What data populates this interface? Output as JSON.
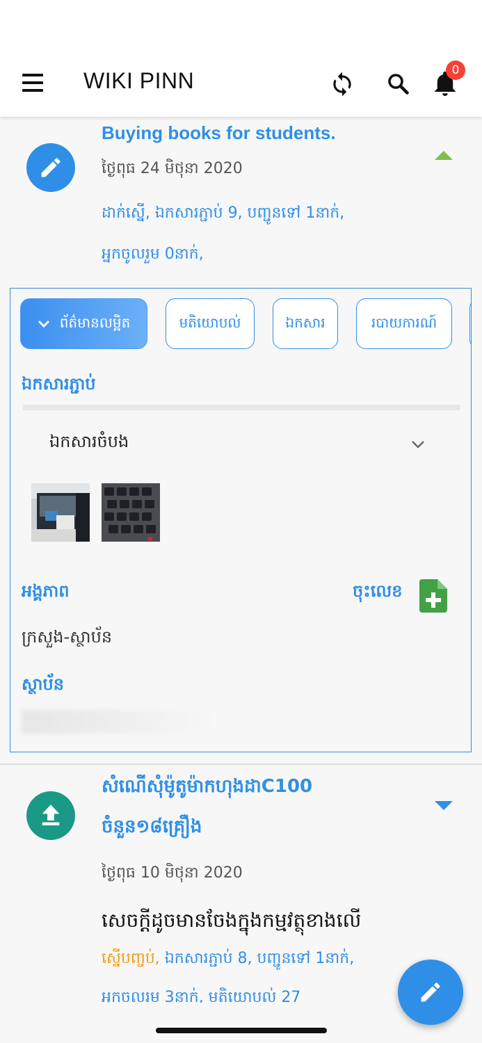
{
  "header": {
    "app_title": "WIKI PINN",
    "notification_count": "0"
  },
  "card1": {
    "title": "Buying books for students.",
    "date": "ថ្ងៃពុធ 24 មិថុនា 2020",
    "meta_line1": "ដាក់ស្នើ, ឯកសារភ្ជាប់ 9, បញ្ជូនទៅ 1នាក់,",
    "meta_line2": "អ្នកចូលរួម 0នាក់,"
  },
  "panel": {
    "tabs": [
      "ព័ត៌មានលម្អិត",
      "មតិយោបល់",
      "ឯកសារ",
      "របាយការណ៍"
    ],
    "attachments_heading": "ឯកសារភ្ជាប់",
    "attachment_group": "ឯកសារចំបង",
    "entity_heading": "អង្គភាព",
    "register_label": "ចុះលេខ",
    "entity_value": "ក្រសួង-ស្ថាប័ន",
    "institution_heading": "ស្ថាប័ន"
  },
  "card2": {
    "title_line1": "សំណើសុំម៉ូតូម៉ាកហុងដាC100",
    "title_line2": "ចំនួន១៨គ្រឿង",
    "date": "ថ្ងៃពុធ 10 មិថុនា 2020",
    "description": "សេចក្តីដូចមានចែងក្នុងកម្មវត្ថុខាងលើ",
    "status": "ស្នើបញ្ចប់,",
    "meta_line1_rest": " ឯកសារភ្ជាប់ 8, បញ្ជូនទៅ 1នាក់,",
    "meta_line2": "អ្នកចូលរួម 3នាក់, មតិយោបល់ 27"
  },
  "colors": {
    "accent": "#2f8fe6",
    "status_orange": "#f39c12",
    "upload_green": "#1a9a86",
    "doc_green": "#43a047",
    "badge_red": "#f44336"
  }
}
